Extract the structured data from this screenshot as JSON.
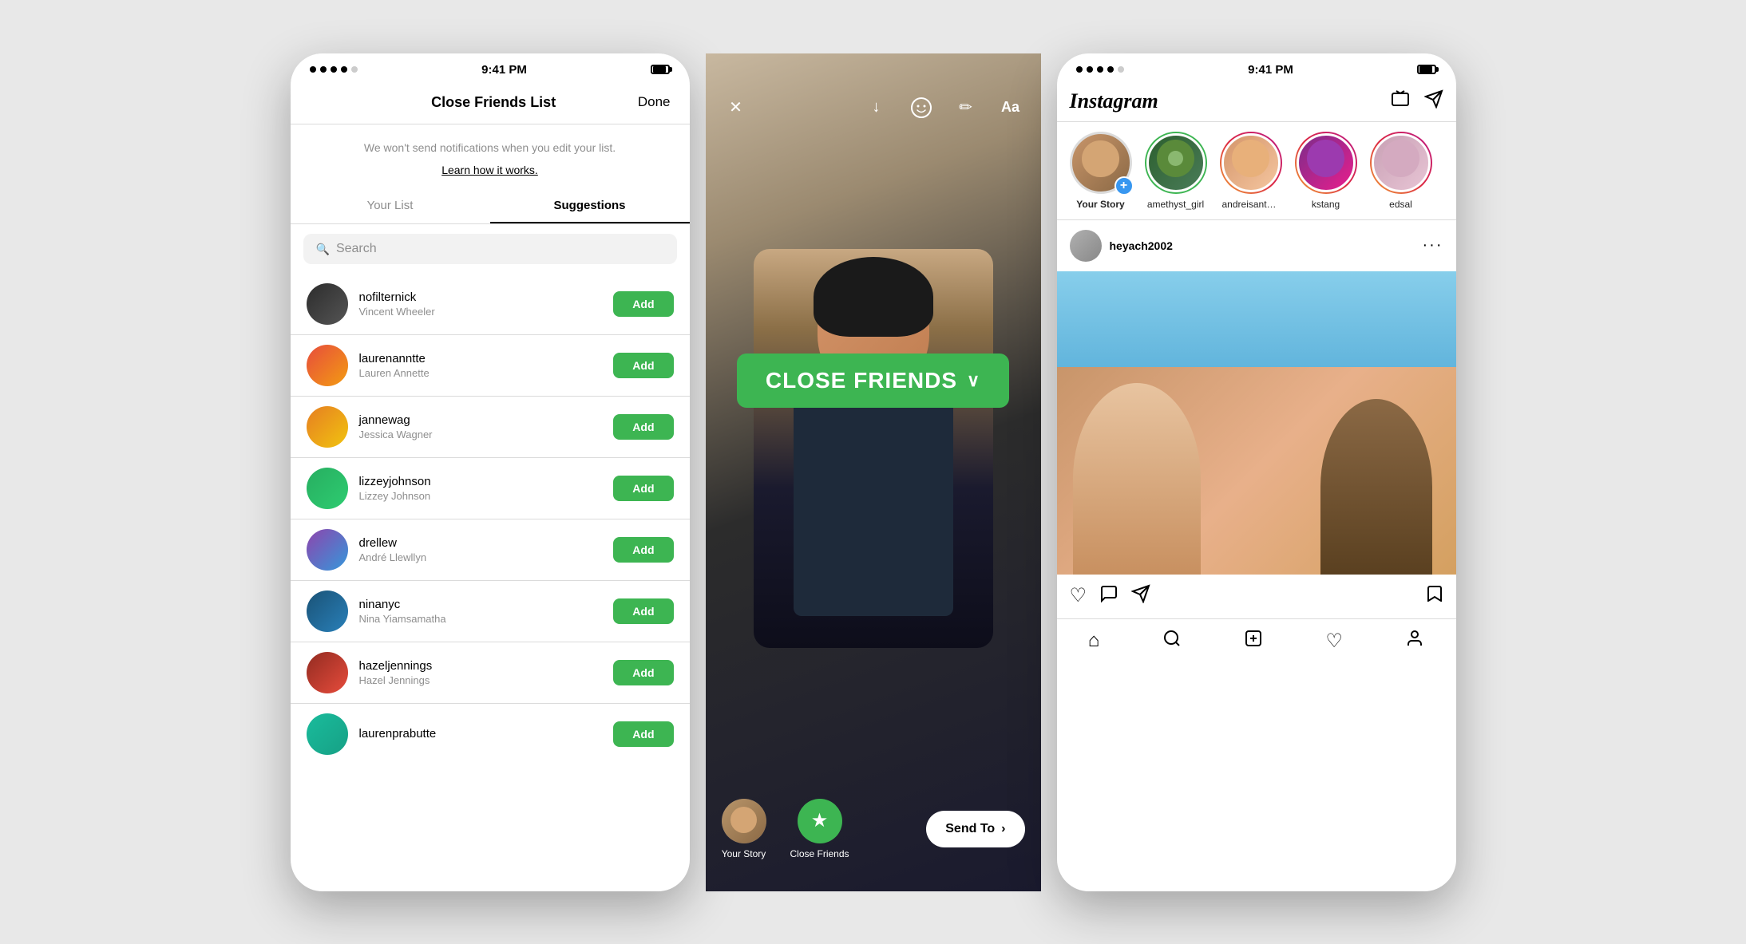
{
  "phone1": {
    "statusBar": {
      "time": "9:41 PM"
    },
    "header": {
      "title": "Close Friends List",
      "doneBtn": "Done"
    },
    "notification": {
      "text": "We won't send notifications when you edit your list.",
      "learnLink": "Learn how it works."
    },
    "tabs": [
      {
        "label": "Your List",
        "active": false
      },
      {
        "label": "Suggestions",
        "active": true
      }
    ],
    "search": {
      "placeholder": "Search"
    },
    "users": [
      {
        "username": "nofilternick",
        "fullname": "Vincent Wheeler",
        "avClass": "av1"
      },
      {
        "username": "laurenanntte",
        "fullname": "Lauren Annette",
        "avClass": "av2"
      },
      {
        "username": "jannewag",
        "fullname": "Jessica Wagner",
        "avClass": "av3"
      },
      {
        "username": "lizzeyjohnson",
        "fullname": "Lizzey Johnson",
        "avClass": "av4"
      },
      {
        "username": "drellew",
        "fullname": "André Llewllyn",
        "avClass": "av5"
      },
      {
        "username": "ninanyc",
        "fullname": "Nina Yiamsamatha",
        "avClass": "av6"
      },
      {
        "username": "hazeljennings",
        "fullname": "Hazel Jennings",
        "avClass": "av7"
      },
      {
        "username": "laurenprabutte",
        "fullname": "",
        "avClass": "av8"
      }
    ],
    "addBtn": "Add"
  },
  "phone2": {
    "closeFriendsBadge": "CLOSE FRIENDS",
    "sendToBtn": "Send To",
    "storyOptions": [
      {
        "label": "Your Story",
        "type": "avatar"
      },
      {
        "label": "Close Friends",
        "type": "star"
      }
    ],
    "icons": {
      "close": "✕",
      "download": "↓",
      "sticker": "☺",
      "draw": "✏",
      "text": "Aa"
    }
  },
  "phone3": {
    "statusBar": {
      "time": "9:41 PM"
    },
    "header": {
      "logo": "Instagram"
    },
    "stories": [
      {
        "label": "Your Story",
        "type": "your-story",
        "hasPlus": true
      },
      {
        "label": "amethyst_girl",
        "type": "green-ring"
      },
      {
        "label": "andreisantalo",
        "type": "gradient-ring"
      },
      {
        "label": "kstang",
        "type": "gradient-ring"
      },
      {
        "label": "edsal",
        "type": "gradient-ring"
      }
    ],
    "post": {
      "username": "heyach2002",
      "moreBtn": "···"
    },
    "navIcons": [
      "home",
      "search",
      "add",
      "heart",
      "person"
    ]
  }
}
